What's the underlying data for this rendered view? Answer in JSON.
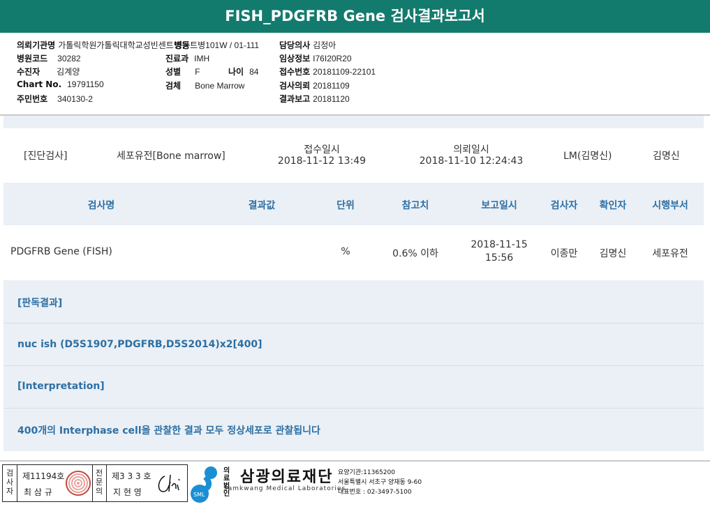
{
  "title": "FISH_PDGFRB Gene 검사결과보고서",
  "header": {
    "col1": [
      {
        "label": "의뢰기관명",
        "value": "가톨릭학원가톨릭대학교성빈센트병원"
      },
      {
        "label": "병원코드",
        "value": "30282"
      },
      {
        "label": "수진자",
        "value": "김계양"
      },
      {
        "label": "Chart No.",
        "value": "19791150"
      },
      {
        "label": "주민번호",
        "value": "340130-2"
      }
    ],
    "col2": [
      {
        "label": "병동",
        "value": "트병101W / 01-111"
      },
      {
        "label": "진료과",
        "value": "IMH"
      },
      {
        "label": "성별",
        "value": "F"
      },
      {
        "label": "검체",
        "value": "Bone Marrow"
      }
    ],
    "age": {
      "label": "나이",
      "value": "84"
    },
    "col3": [
      {
        "label": "담당의사",
        "value": "김정아"
      },
      {
        "label": "임상정보",
        "value": "I76I20R20"
      },
      {
        "label": "접수번호",
        "value": "20181109-22101"
      },
      {
        "label": "검사의뢰",
        "value": "20181109"
      },
      {
        "label": "결과보고",
        "value": "20181120"
      }
    ]
  },
  "info_row": {
    "category": "[진단검사]",
    "specimen": "세포유전[Bone marrow]",
    "received_label": "접수일시",
    "received_value": "2018-11-12 13:49",
    "requested_label": "의뢰일시",
    "requested_value": "2018-11-10 12:24:43",
    "lm": "LM(김명신)",
    "doctor": "김명신"
  },
  "table": {
    "headers": [
      "검사명",
      "결과값",
      "단위",
      "참고치",
      "보고일시",
      "검사자",
      "확인자",
      "시행부서"
    ],
    "row": {
      "name": "PDGFRB Gene (FISH)",
      "result": "",
      "unit": "%",
      "ref": "0.6% 이하",
      "report_date": "2018-11-15",
      "report_time": "15:56",
      "tester": "이종만",
      "confirmer": "김명신",
      "dept": "세포유전"
    }
  },
  "sections": [
    "[판독결과]",
    "nuc ish (D5S1907,PDGFRB,D5S2014)x2[400]",
    "[Interpretation]",
    "400개의 Interphase cell을 관찰한 결과  모두 정상세포로 관찰됩니다"
  ],
  "footer": {
    "tester_label": "검사자",
    "tester_license": "제11194호",
    "tester_name": "최 삼 규",
    "specialist_label": "전문의",
    "specialist_license": "제3 3 3 호",
    "specialist_name": "지 현 영",
    "org_prefix": "의료법인",
    "org_name": "삼광의료재단",
    "org_english": "Samkwang Medical Laboratories",
    "logo_text": "SML",
    "care_code": "요양기관:11365200",
    "address": "서울특별시 서초구 양재동 9-60",
    "phone": "대표번호 : 02-3497-5100"
  },
  "colors": {
    "title_bg": "#137a6e",
    "band": "#eaf0f6",
    "accent_text": "#2e6fa3"
  }
}
